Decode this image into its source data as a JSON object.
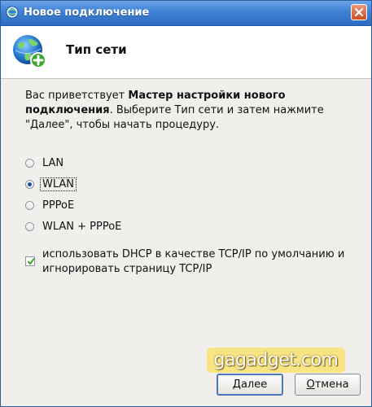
{
  "window": {
    "title": "Новое подключение"
  },
  "header": {
    "title": "Тип сети"
  },
  "intro": {
    "text_before": "Вас приветствует ",
    "bold": "Мастер настройки нового подключения",
    "text_after": ". Выберите Тип сети и затем нажмите \"Далее\", чтобы начать процедуру."
  },
  "network_types": {
    "selected": "WLAN",
    "options": [
      {
        "label": "LAN",
        "checked": false
      },
      {
        "label": "WLAN",
        "checked": true
      },
      {
        "label": "PPPoE",
        "checked": false
      },
      {
        "label": "WLAN + PPPoE",
        "checked": false
      }
    ]
  },
  "dhcp": {
    "checked": true,
    "label": "использовать DHCP в качестве TCP/IP по умолчанию и игнорировать страницу TCP/IP"
  },
  "watermark": {
    "text": "gagadget.com"
  },
  "buttons": {
    "next_first": "Д",
    "next_rest": "алее",
    "cancel_first": "О",
    "cancel_rest": "тмена"
  },
  "colors": {
    "titlebar": "#3f80d4",
    "accent": "#1d4fa8",
    "check": "#2e9a1e"
  },
  "icons": {
    "title": "network-globe-icon",
    "header": "globe-add-icon",
    "close": "close-icon"
  }
}
